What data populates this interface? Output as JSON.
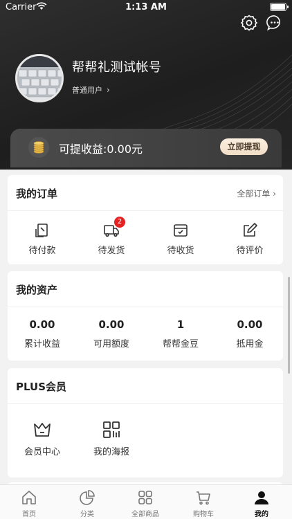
{
  "status_bar": {
    "carrier": "Carrier",
    "time": "1:13 AM",
    "battery_level": 1.0
  },
  "profile": {
    "username": "帮帮礼测试帐号",
    "level": "普通用户"
  },
  "earnings": {
    "label": "可提收益:0.00元",
    "withdraw_button": "立即提现"
  },
  "orders": {
    "title": "我的订单",
    "view_all": "全部订单",
    "items": [
      {
        "label": "待付款",
        "icon": "payment-icon"
      },
      {
        "label": "待发货",
        "icon": "truck-icon",
        "badge": "2"
      },
      {
        "label": "待收货",
        "icon": "package-icon"
      },
      {
        "label": "待评价",
        "icon": "edit-icon"
      }
    ]
  },
  "assets": {
    "title": "我的资产",
    "items": [
      {
        "value": "0.00",
        "label": "累计收益"
      },
      {
        "value": "0.00",
        "label": "可用额度"
      },
      {
        "value": "1",
        "label": "帮帮金豆"
      },
      {
        "value": "0.00",
        "label": "抵用金"
      }
    ]
  },
  "plus": {
    "title": "PLUS会员",
    "items": [
      {
        "label": "会员中心",
        "icon": "crown-icon"
      },
      {
        "label": "我的海报",
        "icon": "qrcode-icon"
      }
    ]
  },
  "tabbar": {
    "items": [
      {
        "label": "首页",
        "icon": "home-icon"
      },
      {
        "label": "分类",
        "icon": "pie-icon"
      },
      {
        "label": "全部商品",
        "icon": "grid-icon"
      },
      {
        "label": "购物车",
        "icon": "cart-icon"
      },
      {
        "label": "我的",
        "icon": "user-icon",
        "active": true
      }
    ]
  }
}
